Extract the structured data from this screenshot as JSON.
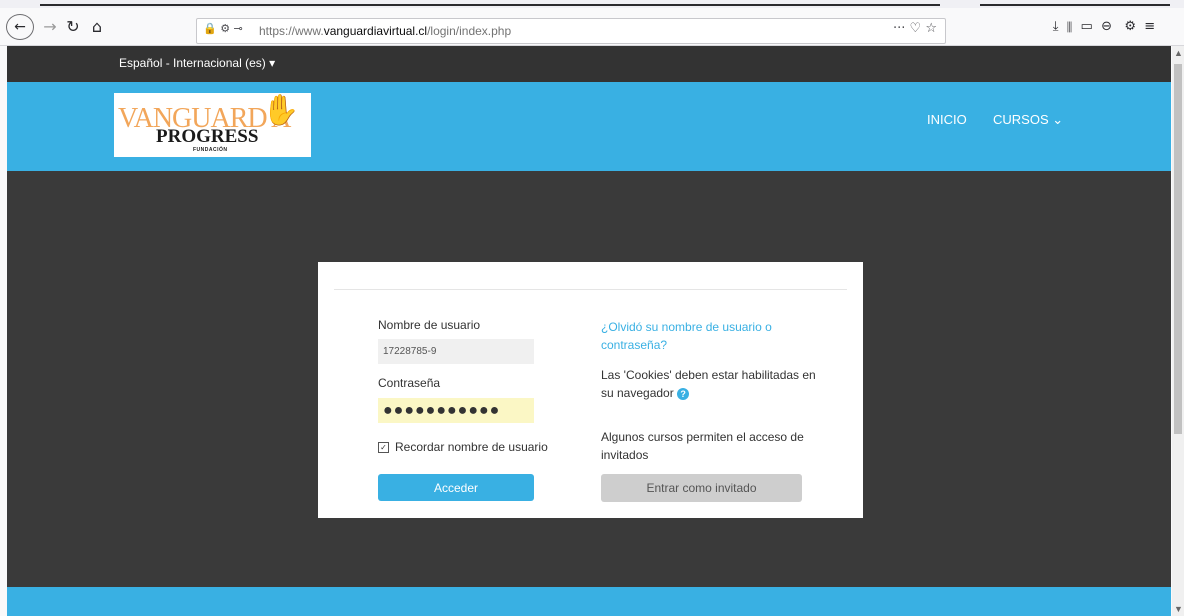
{
  "browser": {
    "url_prefix": "https://www.",
    "url_domain": "vanguardiavirtual.cl",
    "url_path": "/login/index.php",
    "url_lock_icons": "🔒 ⚙ ⊸",
    "url_right_icons": "··· ♡ ☆",
    "toolbar_right_icons": "⤓  ⫴  ▭  ⊖   ⚙  ≡"
  },
  "language": {
    "selected": "Español - Internacional (es)",
    "caret": "▾"
  },
  "brand": {
    "logo_top": "VANGUARD A",
    "logo_mid": "PROGRESS",
    "logo_sub": "FUNDACIÓN"
  },
  "nav": {
    "inicio": "INICIO",
    "cursos": "CURSOS",
    "cursos_caret": "⌄"
  },
  "login": {
    "username_label": "Nombre de usuario",
    "username_value": "17228785-9",
    "password_label": "Contraseña",
    "password_value": "●●●●●●●●●●●",
    "remember_label": "Recordar nombre de usuario",
    "submit_label": "Acceder",
    "forgot_link": "¿Olvidó su nombre de usuario o contraseña?",
    "cookies_text": "Las 'Cookies' deben estar habilitadas en su navegador",
    "help_icon": "?",
    "guest_text": "Algunos cursos permiten el acceso de invitados",
    "guest_button": "Entrar como invitado"
  },
  "colors": {
    "brand_blue": "#39b0e3",
    "dark_bg": "#3a3a3a"
  }
}
